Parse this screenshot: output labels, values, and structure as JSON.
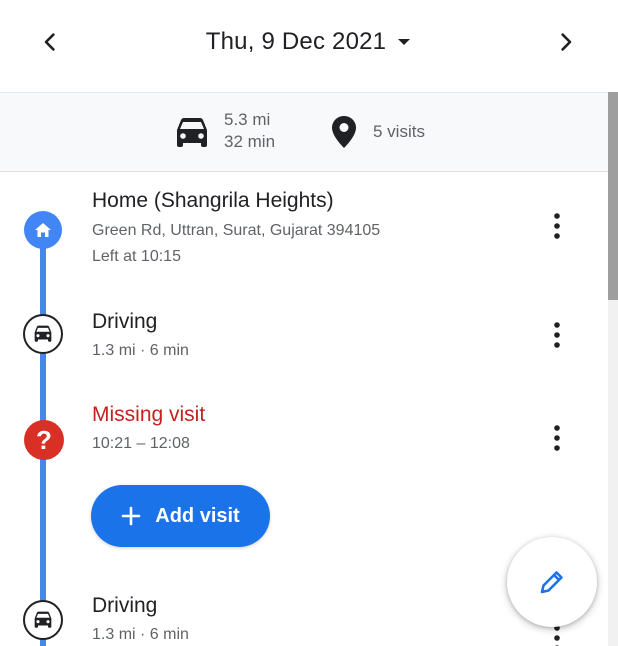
{
  "header": {
    "date": "Thu, 9 Dec 2021"
  },
  "summary": {
    "distance": "5.3 mi",
    "duration": "32 min",
    "visits": "5 visits"
  },
  "timeline": {
    "home": {
      "title": "Home (Shangrila Heights)",
      "address": "Green Rd, Uttran, Surat, Gujarat 394105",
      "left_at": "Left at 10:15"
    },
    "driving_1": {
      "title": "Driving",
      "detail": "1.3 mi · 6 min"
    },
    "missing": {
      "title": "Missing visit",
      "time": "10:21 – 12:08",
      "add_label": "Add visit"
    },
    "driving_2": {
      "title": "Driving",
      "detail": "1.3 mi · 6 min"
    }
  },
  "colors": {
    "accent": "#1a73e8",
    "timeline": "#4a86e8",
    "missing": "#d93025",
    "text": "#202124",
    "secondary": "#5f6368"
  },
  "icons": {
    "prev": "chevron-left-icon",
    "next": "chevron-right-icon",
    "dropdown": "caret-down-icon",
    "car": "car-icon",
    "pin": "place-icon",
    "home": "home-icon",
    "help": "help-icon",
    "more": "more-vert-icon",
    "add": "plus-icon",
    "edit": "pencil-icon"
  }
}
